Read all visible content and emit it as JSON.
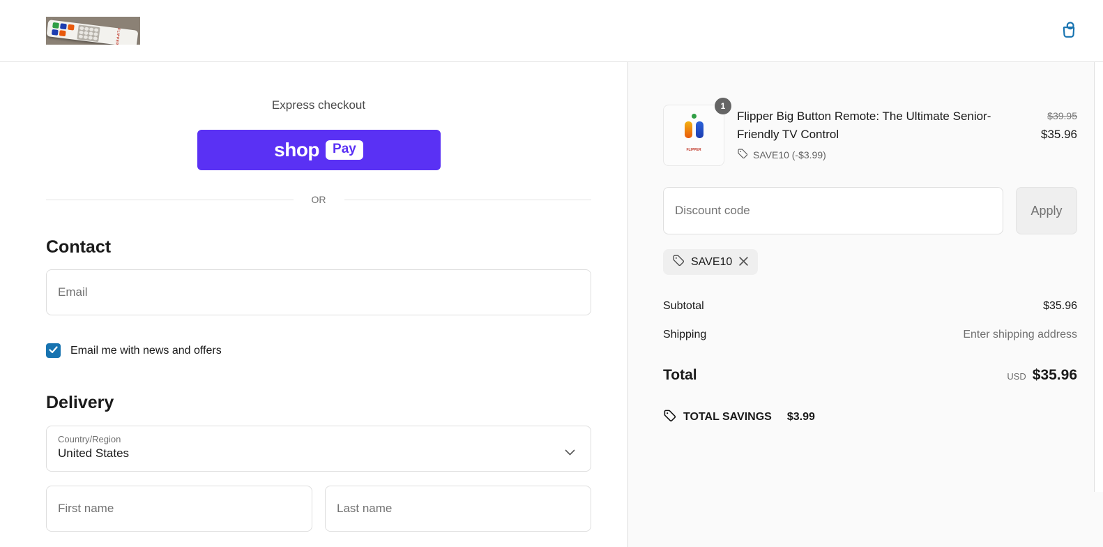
{
  "colors": {
    "accent_blue": "#1773b0",
    "shop_pay_purple": "#5a31f4"
  },
  "header": {
    "logo_alt": "Flipper remote photo logo"
  },
  "express": {
    "title": "Express checkout",
    "shop_pay": {
      "shop": "shop",
      "pay": "Pay"
    },
    "or_label": "OR"
  },
  "contact": {
    "heading": "Contact",
    "email_placeholder": "Email",
    "newsletter_label": "Email me with news and offers",
    "newsletter_checked": true
  },
  "delivery": {
    "heading": "Delivery",
    "country_label": "Country/Region",
    "country_value": "United States",
    "first_name_placeholder": "First name",
    "last_name_placeholder": "Last name"
  },
  "summary": {
    "item": {
      "quantity": "1",
      "title": "Flipper Big Button Remote: The Ultimate Senior-Friendly TV Control",
      "discount_tag": "SAVE10 (-$3.99)",
      "original_price": "$39.95",
      "price": "$35.96"
    },
    "discount": {
      "placeholder": "Discount code",
      "apply_label": "Apply",
      "applied_code": "SAVE10"
    },
    "subtotal_label": "Subtotal",
    "subtotal_value": "$35.96",
    "shipping_label": "Shipping",
    "shipping_value": "Enter shipping address",
    "total_label": "Total",
    "currency": "USD",
    "total_value": "$35.96",
    "savings_label": "TOTAL SAVINGS",
    "savings_value": "$3.99"
  }
}
